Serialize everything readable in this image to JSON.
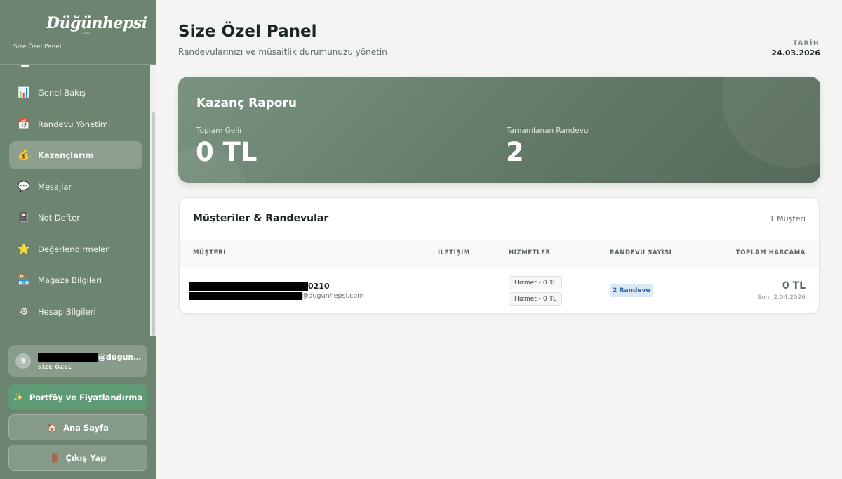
{
  "brand": {
    "logo_text": "Düğünhepsi",
    "logo_domain": ".com",
    "panel_label": "Size Özel Panel"
  },
  "sidebar": {
    "items": [
      {
        "label": "Genel Bakış",
        "icon": "bar-chart-icon",
        "glyph": "📊"
      },
      {
        "label": "Randevu Yönetimi",
        "icon": "calendar-icon",
        "glyph": "📅"
      },
      {
        "label": "Kazançlarım",
        "icon": "money-bag-icon",
        "glyph": "💰",
        "active": true
      },
      {
        "label": "Mesajlar",
        "icon": "speech-bubble-icon",
        "glyph": "💬"
      },
      {
        "label": "Not Defteri",
        "icon": "notebook-icon",
        "glyph": "📓"
      },
      {
        "label": "Değerlendirmeler",
        "icon": "star-icon",
        "glyph": "⭐"
      },
      {
        "label": "Mağaza Bilgileri",
        "icon": "store-icon",
        "glyph": "🏪"
      },
      {
        "label": "Hesap Bilgileri",
        "icon": "gear-icon",
        "glyph": "⚙"
      }
    ],
    "user": {
      "avatar": "S",
      "email_visible": "@dugunhep...",
      "role": "SİZE ÖZEL"
    },
    "portfolio_button": "Portföy ve Fiyatlandırma",
    "home_button": "Ana Sayfa",
    "logout_button": "Çıkış Yap"
  },
  "header": {
    "title": "Size Özel Panel",
    "subtitle": "Randevularınızı ve müsaitlik durumunuzu yönetin",
    "date_label": "TARİH",
    "date_value": "24.03.2026"
  },
  "earnings": {
    "title": "Kazanç Raporu",
    "total_income_label": "Toplam Gelir",
    "total_income_value": "0 TL",
    "completed_label": "Tamamlanan Randevu",
    "completed_value": "2"
  },
  "customers": {
    "title": "Müşteriler & Randevular",
    "count": "1 Müşteri",
    "columns": [
      "MÜŞTERİ",
      "İLETİŞİM",
      "HİZMETLER",
      "RANDEVU SAYISI",
      "TOPLAM HARCAMA"
    ],
    "rows": [
      {
        "name_visible": "0210",
        "email_visible": "@dugunhepsi.com",
        "services": [
          "Hizmet - 0 TL",
          "Hizmet - 0 TL"
        ],
        "appointments": "2 Randevu",
        "total": "0 TL",
        "last": "Son: 2.04.2026"
      }
    ]
  },
  "colors": {
    "sidebar": "#6c8470",
    "earnings_card": "#637a68",
    "portfolio_button": "#5e9a73",
    "badge_bg": "#dbe8f6",
    "badge_text": "#2f5ea6"
  }
}
